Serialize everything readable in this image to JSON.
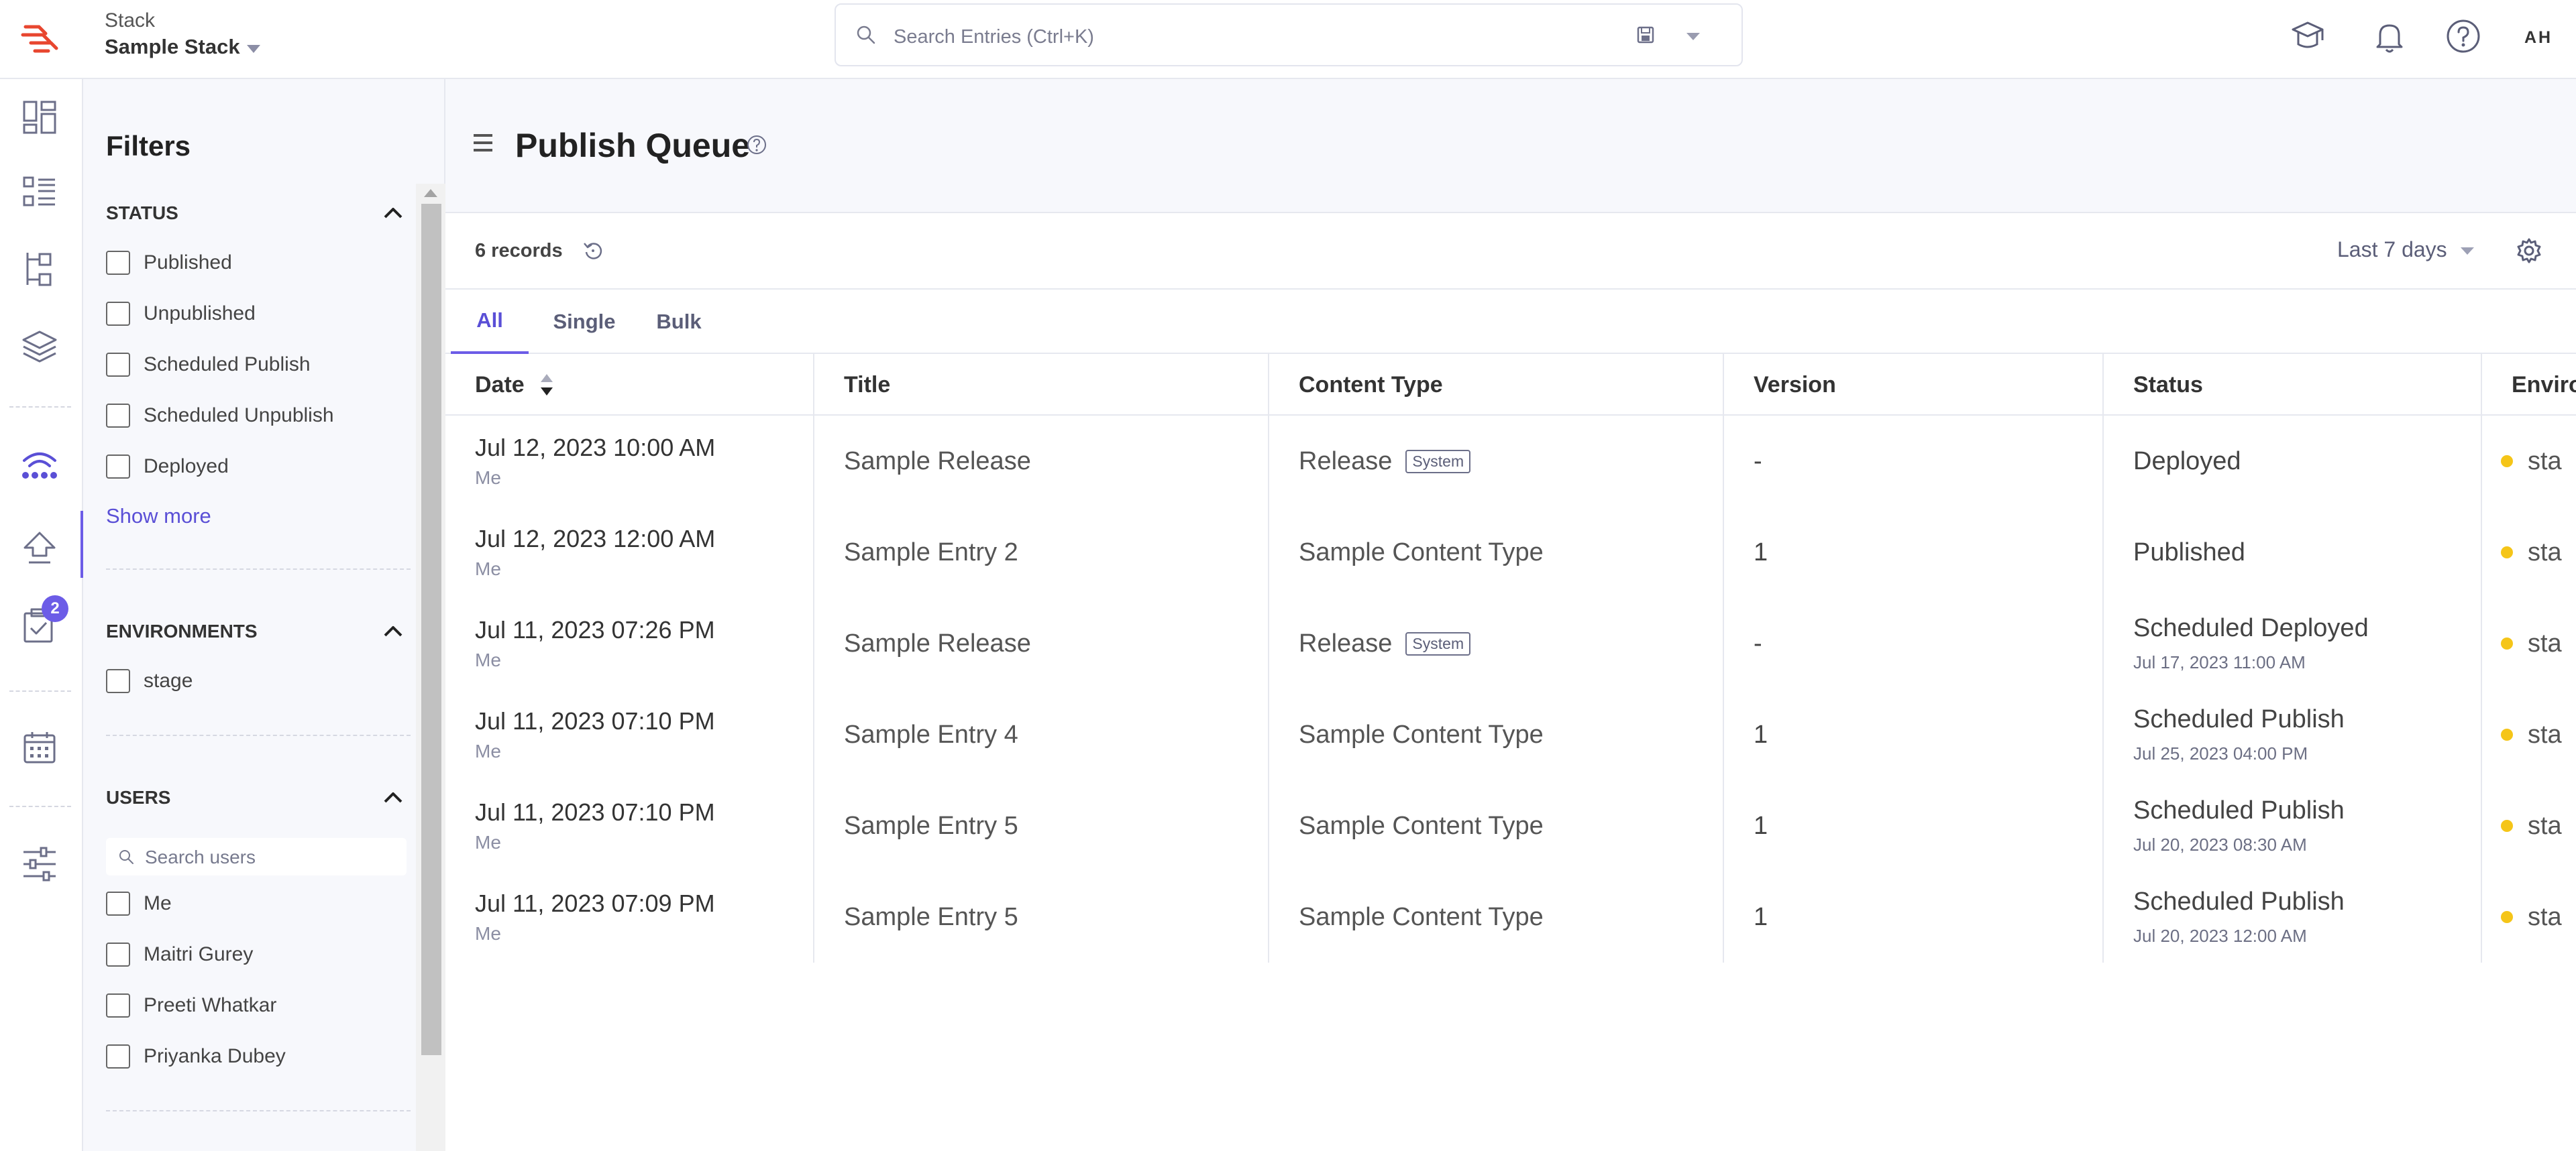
{
  "topbar": {
    "stack_label": "Stack",
    "stack_name": "Sample Stack",
    "search_placeholder": "Search Entries (Ctrl+K)",
    "avatar_initials": "AH"
  },
  "colors": {
    "accent": "#6c5ce7",
    "brand_red": "#e8462f",
    "env_dot": "#f5c518"
  },
  "leftnav": {
    "icons": [
      "dashboard-icon",
      "entries-icon",
      "content-models-icon",
      "assets-icon",
      "releases-icon",
      "publish-queue-icon",
      "workflow-tasks-icon",
      "calendar-icon",
      "settings-sliders-icon"
    ],
    "tasks_badge": "2"
  },
  "filters": {
    "title": "Filters",
    "status": {
      "heading": "STATUS",
      "options": [
        "Published",
        "Unpublished",
        "Scheduled Publish",
        "Scheduled Unpublish",
        "Deployed"
      ],
      "show_more": "Show more"
    },
    "environments": {
      "heading": "ENVIRONMENTS",
      "options": [
        "stage"
      ]
    },
    "users": {
      "heading": "USERS",
      "search_placeholder": "Search users",
      "options": [
        "Me",
        "Maitri Gurey",
        "Preeti Whatkar",
        "Priyanka Dubey"
      ]
    }
  },
  "main": {
    "title": "Publish Queue",
    "records_count": "6 records",
    "date_range": "Last 7 days",
    "tabs": [
      "All",
      "Single",
      "Bulk"
    ],
    "active_tab": "All"
  },
  "table": {
    "columns": [
      "Date",
      "Title",
      "Content Type",
      "Version",
      "Status",
      "Enviro"
    ],
    "rows": [
      {
        "date": "Jul 12, 2023 10:00 AM",
        "user": "Me",
        "title": "Sample Release",
        "content_type": "Release",
        "system_tag": "System",
        "version": "-",
        "status": "Deployed",
        "status_sub": "",
        "env": "sta"
      },
      {
        "date": "Jul 12, 2023 12:00 AM",
        "user": "Me",
        "title": "Sample Entry 2",
        "content_type": "Sample Content Type",
        "system_tag": "",
        "version": "1",
        "status": "Published",
        "status_sub": "",
        "env": "sta"
      },
      {
        "date": "Jul 11, 2023 07:26 PM",
        "user": "Me",
        "title": "Sample Release",
        "content_type": "Release",
        "system_tag": "System",
        "version": "-",
        "status": "Scheduled Deployed",
        "status_sub": "Jul 17, 2023 11:00 AM",
        "env": "sta"
      },
      {
        "date": "Jul 11, 2023 07:10 PM",
        "user": "Me",
        "title": "Sample Entry 4",
        "content_type": "Sample Content Type",
        "system_tag": "",
        "version": "1",
        "status": "Scheduled Publish",
        "status_sub": "Jul 25, 2023 04:00 PM",
        "env": "sta"
      },
      {
        "date": "Jul 11, 2023 07:10 PM",
        "user": "Me",
        "title": "Sample Entry 5",
        "content_type": "Sample Content Type",
        "system_tag": "",
        "version": "1",
        "status": "Scheduled Publish",
        "status_sub": "Jul 20, 2023 08:30 AM",
        "env": "sta"
      },
      {
        "date": "Jul 11, 2023 07:09 PM",
        "user": "Me",
        "title": "Sample Entry 5",
        "content_type": "Sample Content Type",
        "system_tag": "",
        "version": "1",
        "status": "Scheduled Publish",
        "status_sub": "Jul 20, 2023 12:00 AM",
        "env": "sta"
      }
    ]
  }
}
